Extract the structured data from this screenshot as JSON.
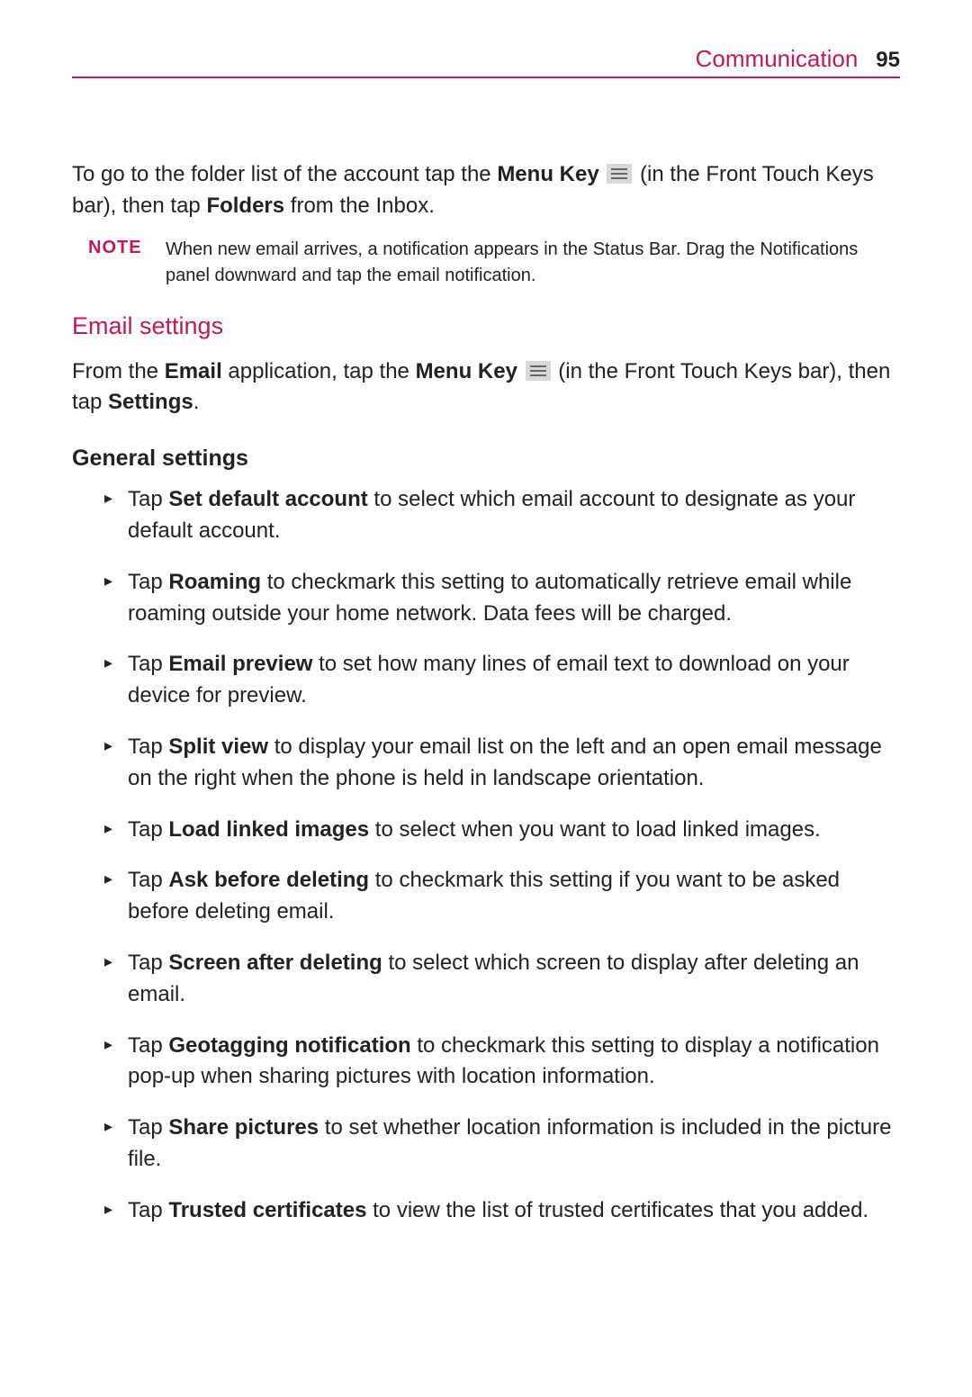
{
  "header": {
    "title": "Communication",
    "page_number": "95"
  },
  "intro": {
    "pre": "To go to the folder list of the account tap the ",
    "menu_key": "Menu Key",
    "post1": " (in the Front Touch Keys bar), then tap ",
    "folders": "Folders",
    "post2": " from the Inbox."
  },
  "note": {
    "label": "NOTE",
    "text": "When new email arrives, a notification appears in the Status Bar. Drag the Notifications panel downward and tap the email notification."
  },
  "email_settings": {
    "heading": "Email settings",
    "intro_pre": "From the ",
    "email": "Email",
    "intro_mid": " application, tap the ",
    "menu_key": "Menu Key",
    "intro_mid2": " (in the Front Touch Keys bar), then tap ",
    "settings": "Settings",
    "intro_post": "."
  },
  "general": {
    "heading": "General settings",
    "items": [
      {
        "pre": "Tap ",
        "bold": "Set default account",
        "post": " to select which email account to designate as your default account."
      },
      {
        "pre": "Tap ",
        "bold": "Roaming",
        "post": " to checkmark this setting to automatically retrieve email while roaming outside your home network. Data fees will be charged."
      },
      {
        "pre": "Tap ",
        "bold": "Email preview",
        "post": " to set how many lines of email text to download on your device for preview."
      },
      {
        "pre": "Tap ",
        "bold": "Split view",
        "post": " to display your email list on the left and an open email message on the right when the phone is held in landscape orientation."
      },
      {
        "pre": "Tap ",
        "bold": "Load linked images",
        "post": " to select when you want to load linked images."
      },
      {
        "pre": "Tap ",
        "bold": "Ask before deleting",
        "post": " to checkmark this setting if you want to be asked before deleting email."
      },
      {
        "pre": "Tap ",
        "bold": "Screen after deleting",
        "post": " to select which screen to display after deleting an email."
      },
      {
        "pre": "Tap ",
        "bold": "Geotagging notification",
        "post": " to checkmark this setting to display a notification pop-up when sharing pictures with location information."
      },
      {
        "pre": "Tap ",
        "bold": "Share pictures",
        "post": " to set whether location information is included in the picture file."
      },
      {
        "pre": "Tap ",
        "bold": "Trusted certificates",
        "post": " to view the list of trusted certificates that you added."
      }
    ]
  }
}
